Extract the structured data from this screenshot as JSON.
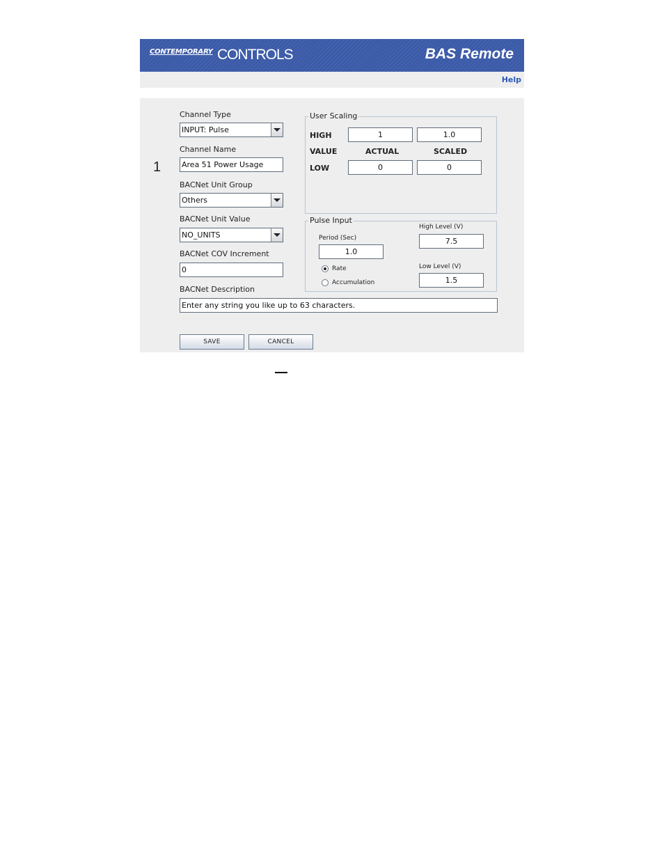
{
  "header": {
    "logo_small": "CONTEMPORARY",
    "logo_big": "CONTROLS",
    "title": "BAS Remote"
  },
  "helpbar": {
    "help": "Help"
  },
  "channel": {
    "number": "1"
  },
  "left": {
    "channel_type_label": "Channel Type",
    "channel_type_value": "INPUT: Pulse",
    "channel_name_label": "Channel Name",
    "channel_name_value": "Area 51 Power Usage",
    "unit_group_label": "BACNet Unit Group",
    "unit_group_value": "Others",
    "unit_value_label": "BACNet Unit Value",
    "unit_value_value": "NO_UNITS",
    "cov_label": "BACNet COV Increment",
    "cov_value": "0",
    "desc_label": "BACNet Description",
    "desc_value": "Enter any string you like up to 63 characters."
  },
  "user_scaling": {
    "legend": "User Scaling",
    "high_label": "HIGH",
    "value_label": "VALUE",
    "low_label": "LOW",
    "actual_label": "ACTUAL",
    "scaled_label": "SCALED",
    "high_actual": "1",
    "high_scaled": "1.0",
    "low_actual": "0",
    "low_scaled": "0"
  },
  "pulse_input": {
    "legend": "Pulse Input",
    "period_label": "Period (Sec)",
    "period_value": "1.0",
    "high_level_label": "High Level (V)",
    "high_level_value": "7.5",
    "low_level_label": "Low Level (V)",
    "low_level_value": "1.5",
    "rate_label": "Rate",
    "accumulation_label": "Accumulation",
    "selected": "Rate"
  },
  "buttons": {
    "save": "SAVE",
    "cancel": "CANCEL"
  }
}
